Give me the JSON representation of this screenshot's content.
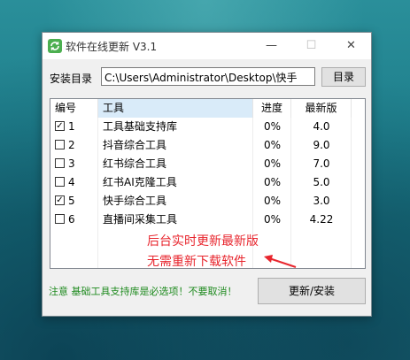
{
  "window": {
    "title": "软件在线更新  V3.1",
    "controls": {
      "minimize": "—",
      "maximize": "☐",
      "close": "✕"
    }
  },
  "install": {
    "label": "安装目录",
    "path": "C:\\Users\\Administrator\\Desktop\\快手",
    "dir_button": "目录"
  },
  "table": {
    "headers": {
      "id": "编号",
      "tool": "工具",
      "progress": "进度",
      "version": "最新版"
    },
    "rows": [
      {
        "checked": true,
        "id": "1",
        "tool": "工具基础支持库",
        "progress": "0%",
        "version": "4.0"
      },
      {
        "checked": false,
        "id": "2",
        "tool": "抖音综合工具",
        "progress": "0%",
        "version": "9.0"
      },
      {
        "checked": false,
        "id": "3",
        "tool": "红书综合工具",
        "progress": "0%",
        "version": "7.0"
      },
      {
        "checked": false,
        "id": "4",
        "tool": "红书AI克隆工具",
        "progress": "0%",
        "version": "5.0"
      },
      {
        "checked": true,
        "id": "5",
        "tool": "快手综合工具",
        "progress": "0%",
        "version": "3.0"
      },
      {
        "checked": false,
        "id": "6",
        "tool": "直播间采集工具",
        "progress": "0%",
        "version": "4.22"
      }
    ]
  },
  "annotation": {
    "line1": "后台实时更新最新版",
    "line2": "无需重新下载软件",
    "color": "#e8262e"
  },
  "footer": {
    "notice": "注意 基础工具支持库是必选项！不要取消！",
    "notice_color": "#1e8a1e",
    "update_button": "更新/安装"
  }
}
